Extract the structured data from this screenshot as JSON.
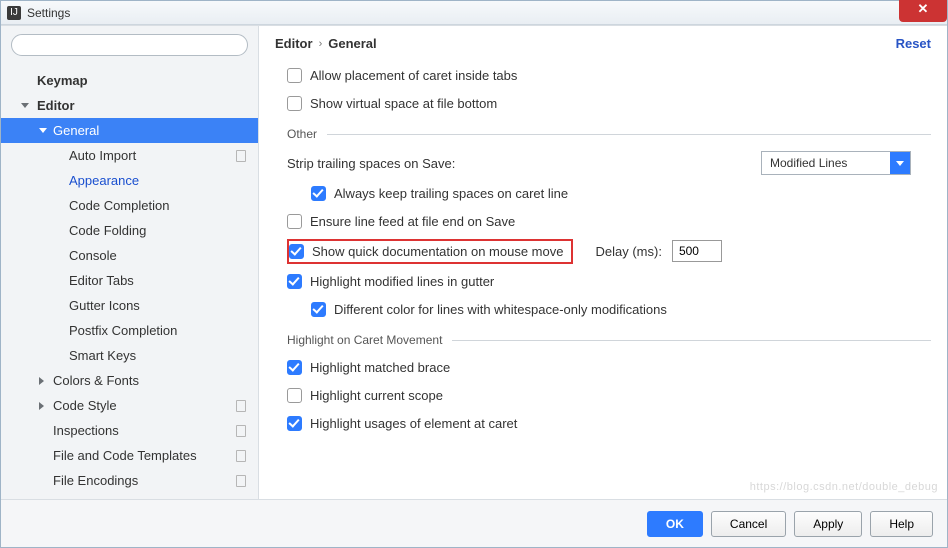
{
  "window": {
    "title": "Settings",
    "close_glyph": "✕"
  },
  "sidebar": {
    "search_placeholder": "",
    "items": [
      {
        "label": "Keymap",
        "level": 1,
        "arrow": null,
        "badge": false
      },
      {
        "label": "Editor",
        "level": 1,
        "arrow": "down",
        "badge": false
      },
      {
        "label": "General",
        "level": 2,
        "arrow": "down",
        "badge": false,
        "selected": true
      },
      {
        "label": "Auto Import",
        "level": 3,
        "badge": true
      },
      {
        "label": "Appearance",
        "level": 3,
        "link": true
      },
      {
        "label": "Code Completion",
        "level": 3
      },
      {
        "label": "Code Folding",
        "level": 3
      },
      {
        "label": "Console",
        "level": 3
      },
      {
        "label": "Editor Tabs",
        "level": 3
      },
      {
        "label": "Gutter Icons",
        "level": 3
      },
      {
        "label": "Postfix Completion",
        "level": 3
      },
      {
        "label": "Smart Keys",
        "level": 3
      },
      {
        "label": "Colors & Fonts",
        "level": 2,
        "arrow": "right"
      },
      {
        "label": "Code Style",
        "level": 2,
        "arrow": "right",
        "badge": true
      },
      {
        "label": "Inspections",
        "level": 2,
        "badge": true
      },
      {
        "label": "File and Code Templates",
        "level": 2,
        "badge": true
      },
      {
        "label": "File Encodings",
        "level": 2,
        "badge": true
      }
    ]
  },
  "breadcrumb": {
    "a": "Editor",
    "b": "General",
    "reset": "Reset"
  },
  "options": {
    "caret_tabs": {
      "label": "Allow placement of caret inside tabs",
      "checked": false
    },
    "virtual_space": {
      "label": "Show virtual space at file bottom",
      "checked": false
    },
    "strip_label": "Strip trailing spaces on Save:",
    "strip_value": "Modified Lines",
    "keep_trailing": {
      "label": "Always keep trailing spaces on caret line",
      "checked": true
    },
    "line_feed": {
      "label": "Ensure line feed at file end on Save",
      "checked": false
    },
    "quick_doc": {
      "label": "Show quick documentation on mouse move",
      "checked": true
    },
    "delay_label": "Delay (ms):",
    "delay_value": "500",
    "highlight_gutter": {
      "label": "Highlight modified lines in gutter",
      "checked": true
    },
    "diff_color": {
      "label": "Different color for lines with whitespace-only modifications",
      "checked": true
    },
    "brace": {
      "label": "Highlight matched brace",
      "checked": true
    },
    "scope": {
      "label": "Highlight current scope",
      "checked": false
    },
    "usages": {
      "label": "Highlight usages of element at caret",
      "checked": true
    }
  },
  "sections": {
    "other": "Other",
    "caret": "Highlight on Caret Movement"
  },
  "footer": {
    "ok": "OK",
    "cancel": "Cancel",
    "apply": "Apply",
    "help": "Help"
  },
  "watermark": "https://blog.csdn.net/double_debug"
}
